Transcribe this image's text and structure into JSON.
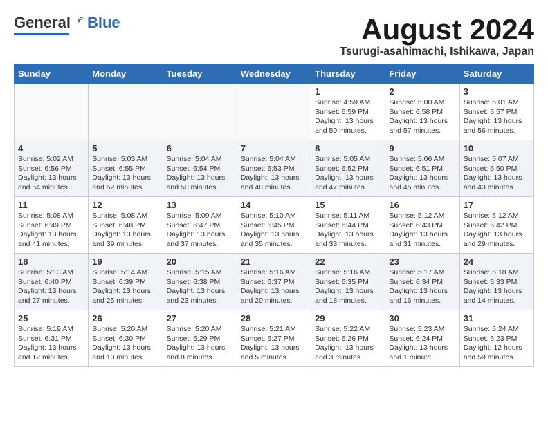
{
  "header": {
    "logo_general": "General",
    "logo_blue": "Blue",
    "main_title": "August 2024",
    "subtitle": "Tsurugi-asahimachi, Ishikawa, Japan"
  },
  "days_of_week": [
    "Sunday",
    "Monday",
    "Tuesday",
    "Wednesday",
    "Thursday",
    "Friday",
    "Saturday"
  ],
  "weeks": [
    {
      "shaded": false,
      "days": [
        {
          "num": "",
          "text": ""
        },
        {
          "num": "",
          "text": ""
        },
        {
          "num": "",
          "text": ""
        },
        {
          "num": "",
          "text": ""
        },
        {
          "num": "1",
          "text": "Sunrise: 4:59 AM\nSunset: 6:59 PM\nDaylight: 13 hours\nand 59 minutes."
        },
        {
          "num": "2",
          "text": "Sunrise: 5:00 AM\nSunset: 6:58 PM\nDaylight: 13 hours\nand 57 minutes."
        },
        {
          "num": "3",
          "text": "Sunrise: 5:01 AM\nSunset: 6:57 PM\nDaylight: 13 hours\nand 56 minutes."
        }
      ]
    },
    {
      "shaded": true,
      "days": [
        {
          "num": "4",
          "text": "Sunrise: 5:02 AM\nSunset: 6:56 PM\nDaylight: 13 hours\nand 54 minutes."
        },
        {
          "num": "5",
          "text": "Sunrise: 5:03 AM\nSunset: 6:55 PM\nDaylight: 13 hours\nand 52 minutes."
        },
        {
          "num": "6",
          "text": "Sunrise: 5:04 AM\nSunset: 6:54 PM\nDaylight: 13 hours\nand 50 minutes."
        },
        {
          "num": "7",
          "text": "Sunrise: 5:04 AM\nSunset: 6:53 PM\nDaylight: 13 hours\nand 48 minutes."
        },
        {
          "num": "8",
          "text": "Sunrise: 5:05 AM\nSunset: 6:52 PM\nDaylight: 13 hours\nand 47 minutes."
        },
        {
          "num": "9",
          "text": "Sunrise: 5:06 AM\nSunset: 6:51 PM\nDaylight: 13 hours\nand 45 minutes."
        },
        {
          "num": "10",
          "text": "Sunrise: 5:07 AM\nSunset: 6:50 PM\nDaylight: 13 hours\nand 43 minutes."
        }
      ]
    },
    {
      "shaded": false,
      "days": [
        {
          "num": "11",
          "text": "Sunrise: 5:08 AM\nSunset: 6:49 PM\nDaylight: 13 hours\nand 41 minutes."
        },
        {
          "num": "12",
          "text": "Sunrise: 5:08 AM\nSunset: 6:48 PM\nDaylight: 13 hours\nand 39 minutes."
        },
        {
          "num": "13",
          "text": "Sunrise: 5:09 AM\nSunset: 6:47 PM\nDaylight: 13 hours\nand 37 minutes."
        },
        {
          "num": "14",
          "text": "Sunrise: 5:10 AM\nSunset: 6:45 PM\nDaylight: 13 hours\nand 35 minutes."
        },
        {
          "num": "15",
          "text": "Sunrise: 5:11 AM\nSunset: 6:44 PM\nDaylight: 13 hours\nand 33 minutes."
        },
        {
          "num": "16",
          "text": "Sunrise: 5:12 AM\nSunset: 6:43 PM\nDaylight: 13 hours\nand 31 minutes."
        },
        {
          "num": "17",
          "text": "Sunrise: 5:12 AM\nSunset: 6:42 PM\nDaylight: 13 hours\nand 29 minutes."
        }
      ]
    },
    {
      "shaded": true,
      "days": [
        {
          "num": "18",
          "text": "Sunrise: 5:13 AM\nSunset: 6:40 PM\nDaylight: 13 hours\nand 27 minutes."
        },
        {
          "num": "19",
          "text": "Sunrise: 5:14 AM\nSunset: 6:39 PM\nDaylight: 13 hours\nand 25 minutes."
        },
        {
          "num": "20",
          "text": "Sunrise: 5:15 AM\nSunset: 6:38 PM\nDaylight: 13 hours\nand 23 minutes."
        },
        {
          "num": "21",
          "text": "Sunrise: 5:16 AM\nSunset: 6:37 PM\nDaylight: 13 hours\nand 20 minutes."
        },
        {
          "num": "22",
          "text": "Sunrise: 5:16 AM\nSunset: 6:35 PM\nDaylight: 13 hours\nand 18 minutes."
        },
        {
          "num": "23",
          "text": "Sunrise: 5:17 AM\nSunset: 6:34 PM\nDaylight: 13 hours\nand 16 minutes."
        },
        {
          "num": "24",
          "text": "Sunrise: 5:18 AM\nSunset: 6:33 PM\nDaylight: 13 hours\nand 14 minutes."
        }
      ]
    },
    {
      "shaded": false,
      "days": [
        {
          "num": "25",
          "text": "Sunrise: 5:19 AM\nSunset: 6:31 PM\nDaylight: 13 hours\nand 12 minutes."
        },
        {
          "num": "26",
          "text": "Sunrise: 5:20 AM\nSunset: 6:30 PM\nDaylight: 13 hours\nand 10 minutes."
        },
        {
          "num": "27",
          "text": "Sunrise: 5:20 AM\nSunset: 6:29 PM\nDaylight: 13 hours\nand 8 minutes."
        },
        {
          "num": "28",
          "text": "Sunrise: 5:21 AM\nSunset: 6:27 PM\nDaylight: 13 hours\nand 5 minutes."
        },
        {
          "num": "29",
          "text": "Sunrise: 5:22 AM\nSunset: 6:26 PM\nDaylight: 13 hours\nand 3 minutes."
        },
        {
          "num": "30",
          "text": "Sunrise: 5:23 AM\nSunset: 6:24 PM\nDaylight: 13 hours\nand 1 minute."
        },
        {
          "num": "31",
          "text": "Sunrise: 5:24 AM\nSunset: 6:23 PM\nDaylight: 12 hours\nand 59 minutes."
        }
      ]
    }
  ]
}
